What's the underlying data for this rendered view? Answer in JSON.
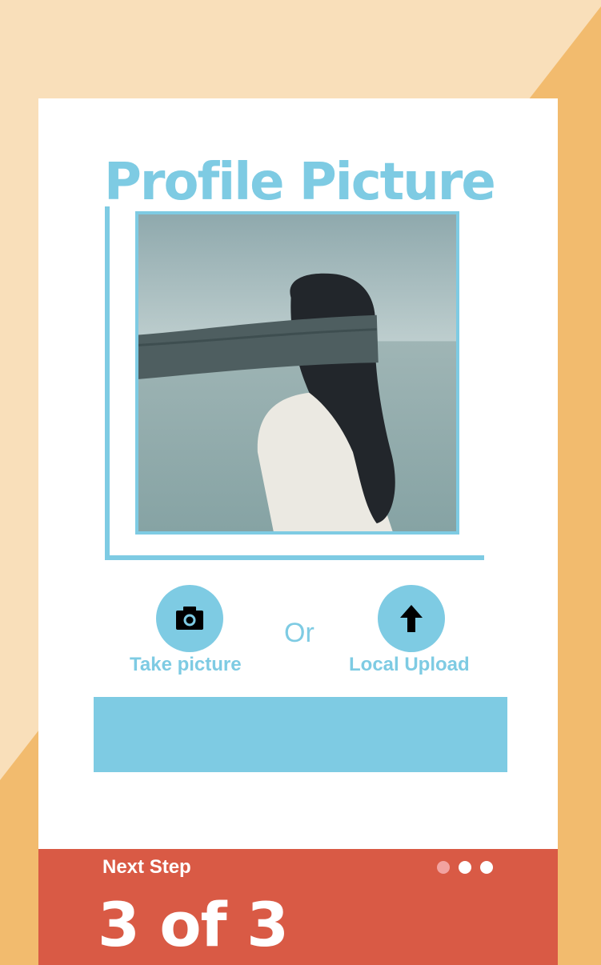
{
  "colors": {
    "background_light": "#f9dfba",
    "background_dark": "#f2bb6e",
    "accent": "#7ecbe3",
    "footer": "#d95a45",
    "card": "#ffffff"
  },
  "page": {
    "title": "Profile Picture"
  },
  "photo": {
    "alt": "Profile photo"
  },
  "actions": {
    "take_picture": {
      "label": "Take picture",
      "icon": "camera-icon"
    },
    "separator": "Or",
    "local_upload": {
      "label": "Local Upload",
      "icon": "upload-arrow-icon"
    }
  },
  "input": {
    "value": "",
    "placeholder": ""
  },
  "footer": {
    "next_label": "Next Step",
    "step_text": "3 of 3",
    "current_step": 3,
    "total_steps": 3
  }
}
